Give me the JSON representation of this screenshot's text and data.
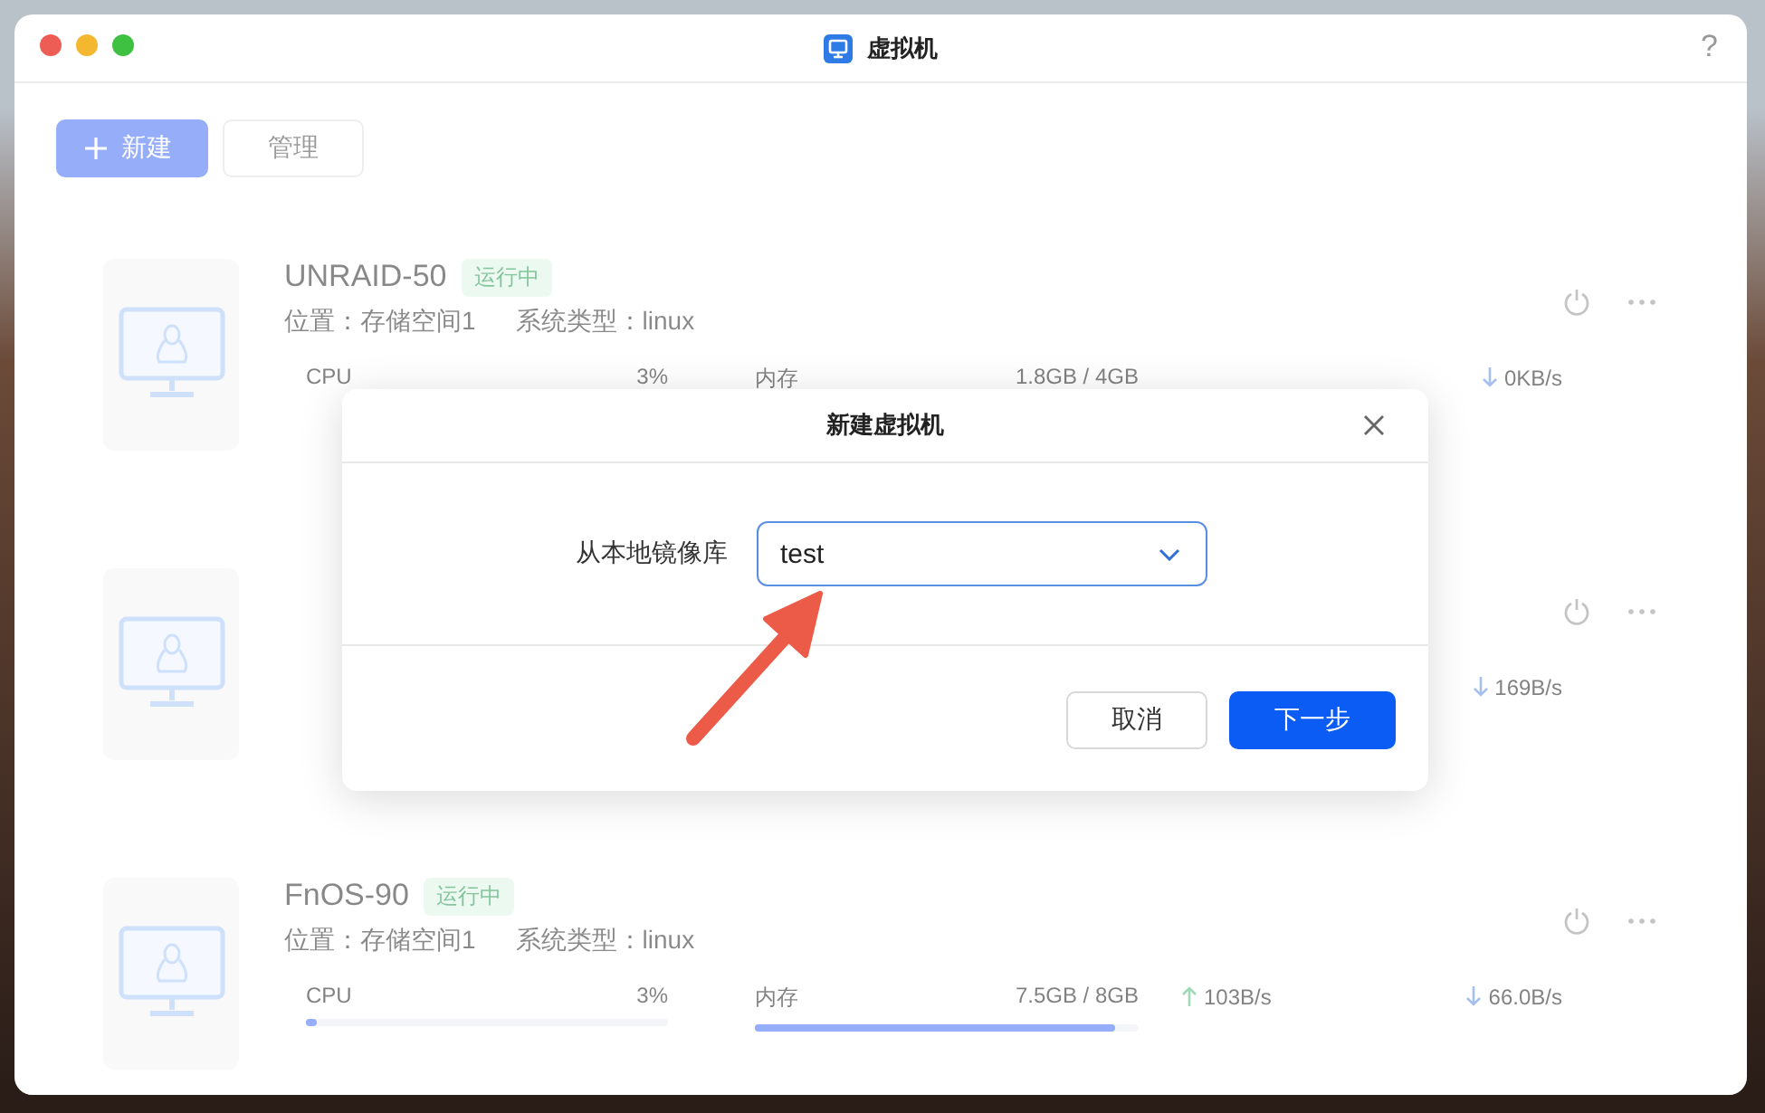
{
  "window": {
    "title": "虚拟机",
    "help": "?"
  },
  "toolbar": [
    {
      "label": "新建",
      "kind": "primary"
    },
    {
      "label": "管理",
      "kind": "plain"
    }
  ],
  "vms": [
    {
      "name": "UNRAID-50",
      "status": "运行中",
      "location": "位置：存储空间1",
      "system": "系统类型：linux",
      "cpu": {
        "label": "CPU",
        "value": "3%"
      },
      "memory": {
        "label": "内存",
        "value": "1.8GB / 4GB"
      },
      "download": "0KB/s"
    },
    {
      "download": "169B/s"
    },
    {
      "name": "FnOS-90",
      "status": "运行中",
      "location": "位置：存储空间1",
      "system": "系统类型：linux",
      "cpu": {
        "label": "CPU",
        "value": "3%",
        "level": 0.03
      },
      "memory": {
        "label": "内存",
        "value": "7.5GB / 8GB",
        "level": 0.94
      },
      "upload": "103B/s",
      "download": "66.0B/s"
    }
  ],
  "dialog": {
    "title": "新建虚拟机",
    "field_label": "从本地镜像库",
    "select_value": "test",
    "buttons": [
      {
        "label": "取消",
        "kind": "secondary"
      },
      {
        "label": "下一步",
        "kind": "primary"
      }
    ]
  }
}
